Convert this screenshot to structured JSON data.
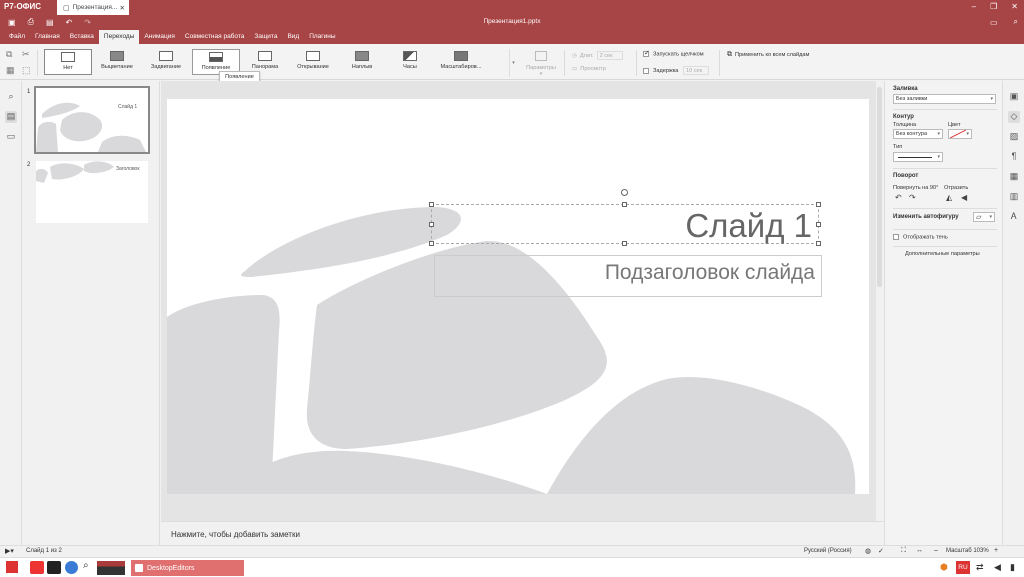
{
  "app": {
    "logo": "Р7-ОФИС",
    "doc_tab": "Презентация...",
    "doc_title": "Презентация1.pptx"
  },
  "menu": {
    "tabs": [
      "Файл",
      "Главная",
      "Вставка",
      "Переходы",
      "Анимация",
      "Совместная работа",
      "Защита",
      "Вид",
      "Плагины"
    ],
    "active_index": 3
  },
  "ribbon": {
    "transitions": [
      "Нет",
      "Выцветание",
      "Задвигание",
      "Появление",
      "Панорама",
      "Открывание",
      "Наплыв",
      "Часы",
      "Масштабиров..."
    ],
    "selected_index": 3,
    "tooltip": "Появление",
    "params_label": "Параметры",
    "duration_label": "Длит.",
    "duration_value": "2 сек",
    "preview_label": "Просмотр",
    "start_on_click_label": "Запускать щелчком",
    "start_on_click_checked": true,
    "delay_label": "Задержка",
    "delay_value": "10 сек",
    "delay_checked": false,
    "apply_all_label": "Применить ко всем слайдам"
  },
  "slides_panel": {
    "items": [
      {
        "number": "1",
        "title": "Слайд 1"
      },
      {
        "number": "2",
        "title": "Заголовок"
      }
    ]
  },
  "slide": {
    "title": "Слайд 1",
    "subtitle": "Подзаголовок слайда"
  },
  "notes_placeholder": "Нажмите, чтобы добавить заметки",
  "right_panel": {
    "fill_header": "Заливка",
    "fill_value": "Без заливки",
    "outline_header": "Контур",
    "thickness_label": "Толщина",
    "thickness_value": "Без контура",
    "color_label": "Цвет",
    "type_label": "Тип",
    "rotation_header": "Поворот",
    "rotate90_label": "Повернуть на 90°",
    "flip_label": "Отразить",
    "change_shape_label": "Изменить автофигуру",
    "shadow_label": "Отображать тень",
    "shadow_checked": false,
    "advanced_label": "Дополнительные параметры"
  },
  "status": {
    "slide_counter": "Слайд 1 из 2",
    "language": "Русский (Россия)",
    "zoom_label": "Масштаб 103%"
  },
  "taskbar": {
    "app_label": "DesktopEditors",
    "lang_badge": "RU"
  },
  "colors": {
    "brand": "#a74445",
    "shape_gray": "#d9d8da",
    "taskbar_app": "#e0706f"
  }
}
